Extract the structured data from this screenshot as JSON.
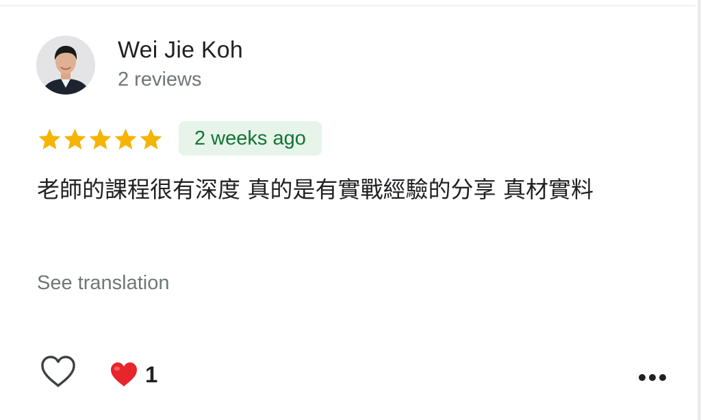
{
  "reviewer": {
    "name": "Wei Jie Koh",
    "review_count": "2 reviews"
  },
  "review": {
    "rating": 5,
    "max_rating": 5,
    "date": "2 weeks ago",
    "text": "老師的課程很有深度 真的是有實戰經驗的分享 真材實料",
    "see_translation": "See translation"
  },
  "actions": {
    "reaction_count": "1",
    "like_icon": "heart-outline-icon",
    "reaction_icon": "red-heart-icon",
    "more_icon": "more-horizontal-icon"
  },
  "colors": {
    "star": "#f5b400",
    "date_badge_bg": "#e6f4ea",
    "date_badge_text": "#137333",
    "secondary_text": "#70757a",
    "reaction_heart": "#e8252b"
  }
}
